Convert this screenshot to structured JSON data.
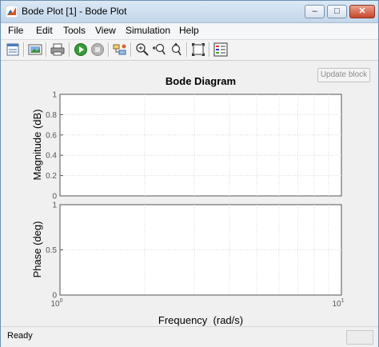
{
  "window": {
    "title": "Bode Plot [1] - Bode Plot",
    "minimize": "–",
    "maximize": "□",
    "close": "✕"
  },
  "menu": [
    "File",
    "Edit",
    "Tools",
    "View",
    "Simulation",
    "Help"
  ],
  "toolbar_icons": [
    "new-figure-icon",
    "print-preview-icon",
    "print-icon",
    "run-icon",
    "stop-icon",
    "block-params-icon",
    "zoom-in-icon",
    "zoom-x-icon",
    "zoom-y-icon",
    "autoscale-icon",
    "legend-icon"
  ],
  "update_block": "Update block",
  "status": "Ready",
  "chart_data": [
    {
      "type": "line",
      "title": "Bode Diagram",
      "ylabel": "Magnitude (dB)",
      "ylim": [
        0,
        1
      ],
      "yticks": [
        "0",
        "0.2",
        "0.4",
        "0.6",
        "0.8",
        "1"
      ],
      "xscale": "log",
      "xlim": [
        1,
        10
      ],
      "grid": true,
      "series": []
    },
    {
      "type": "line",
      "xlabel": "Frequency  (rad/s)",
      "ylabel": "Phase (deg)",
      "ylim": [
        0,
        1
      ],
      "yticks": [
        "0",
        "0.5",
        "1"
      ],
      "xticks": [
        "10",
        "10"
      ],
      "xtick_exponents": [
        "0",
        "1"
      ],
      "xscale": "log",
      "xlim": [
        1,
        10
      ],
      "grid": true,
      "series": []
    }
  ]
}
